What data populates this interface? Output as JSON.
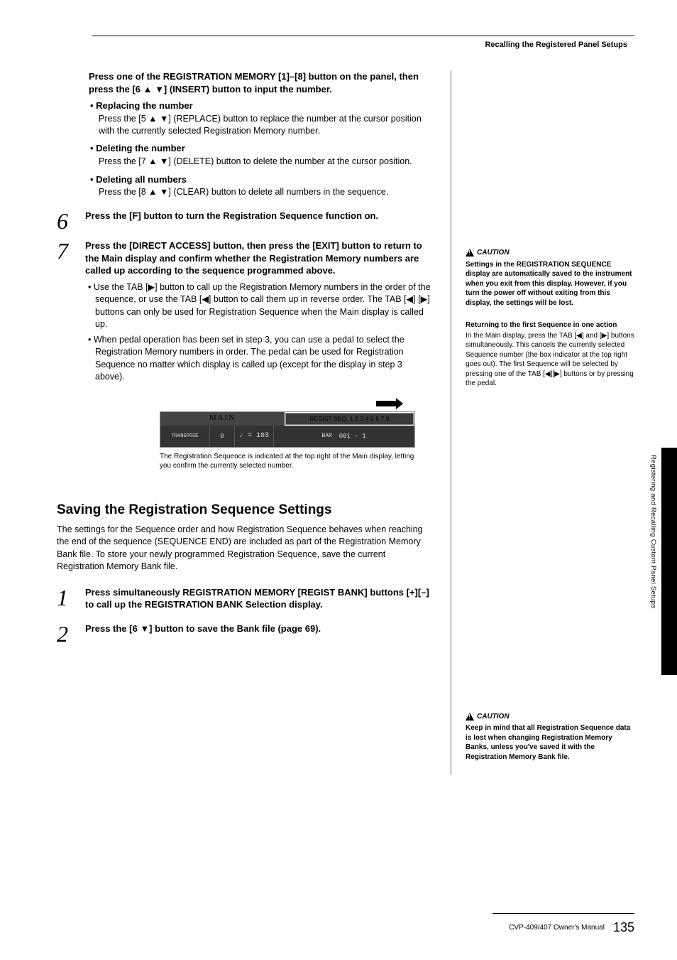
{
  "header": {
    "breadcrumb": "Recalling the Registered Panel Setups"
  },
  "intro": {
    "title": "Press one of the REGISTRATION MEMORY [1]–[8] button on the panel, then press the [6 ▲ ▼] (INSERT) button to input the number.",
    "b1_title": "Replacing the number",
    "b1_body": "Press the [5 ▲ ▼] (REPLACE) button to replace the number at the cursor position with the currently selected Registration Memory number.",
    "b2_title": "Deleting the number",
    "b2_body": "Press the [7 ▲ ▼] (DELETE) button to delete the number at the cursor position.",
    "b3_title": "Deleting all numbers",
    "b3_body": "Press the [8 ▲ ▼] (CLEAR) button to delete all numbers in the sequence."
  },
  "step6": {
    "num": "6",
    "text": "Press the [F] button to turn the Registration Sequence function on."
  },
  "step7": {
    "num": "7",
    "title": "Press the [DIRECT ACCESS] button, then press the [EXIT] button to return to the Main display and confirm whether the Registration Memory numbers are called up according to the sequence programmed above.",
    "sb1": "Use the TAB [▶] button to call up the Registration Memory numbers in the order of the sequence, or use the TAB [◀] button to call them up in reverse order. The TAB [◀] [▶] buttons can only be used for Registration Sequence when the Main display is called up.",
    "sb2": "When pedal operation has been set in step 3, you can use a pedal to select the Registration Memory numbers in order. The pedal can be used for Registration Sequence no matter which display is called up (except for the display in step 3 above)."
  },
  "lcd": {
    "main_label": "MAIN",
    "regist_label": "REGIST SEQ. 1 2 3 4 5 6 7 8",
    "transpose_label": "TRANSPOSE",
    "transpose_val": "0",
    "tempo": "♩ = 103",
    "bar_label": "BAR",
    "bar_val": "001 - 1"
  },
  "caption": "The Registration Sequence is indicated at the top right of the Main display, letting you confirm the currently selected number.",
  "section": {
    "title": "Saving the Registration Sequence Settings",
    "para": "The settings for the Sequence order and how Registration Sequence behaves when reaching the end of the sequence (SEQUENCE END) are included as part of the Registration Memory Bank file. To store your newly programmed Registration Sequence, save the current Registration Memory Bank file."
  },
  "save_step1": {
    "num": "1",
    "text": "Press simultaneously REGISTRATION MEMORY [REGIST BANK] buttons [+][–] to call up the REGISTRATION BANK Selection display."
  },
  "save_step2": {
    "num": "2",
    "text": "Press the [6 ▼] button to save the Bank file (page 69)."
  },
  "caution1": {
    "label": "CAUTION",
    "text": "Settings in the REGISTRATION SEQUENCE display are automatically saved to the instrument when you exit from this display. However, if you turn the power off without exiting from this display, the settings will be lost."
  },
  "note": {
    "title": "Returning to the first Sequence in one action",
    "text": "In the Main display, press the TAB [◀] and [▶] buttons simultaneously. This cancels the currently selected Sequence number (the box indicator at the top right goes out). The first Sequence will be selected by pressing one of the TAB [◀][▶] buttons or by pressing the pedal."
  },
  "caution2": {
    "label": "CAUTION",
    "text": "Keep in mind that all Registration Sequence data is lost when changing Registration Memory Banks, unless you've saved it with the Registration Memory Bank file."
  },
  "side_text": "Registering and Recalling Custom Panel Setups",
  "footer": {
    "manual": "CVP-409/407 Owner's Manual",
    "page": "135"
  }
}
